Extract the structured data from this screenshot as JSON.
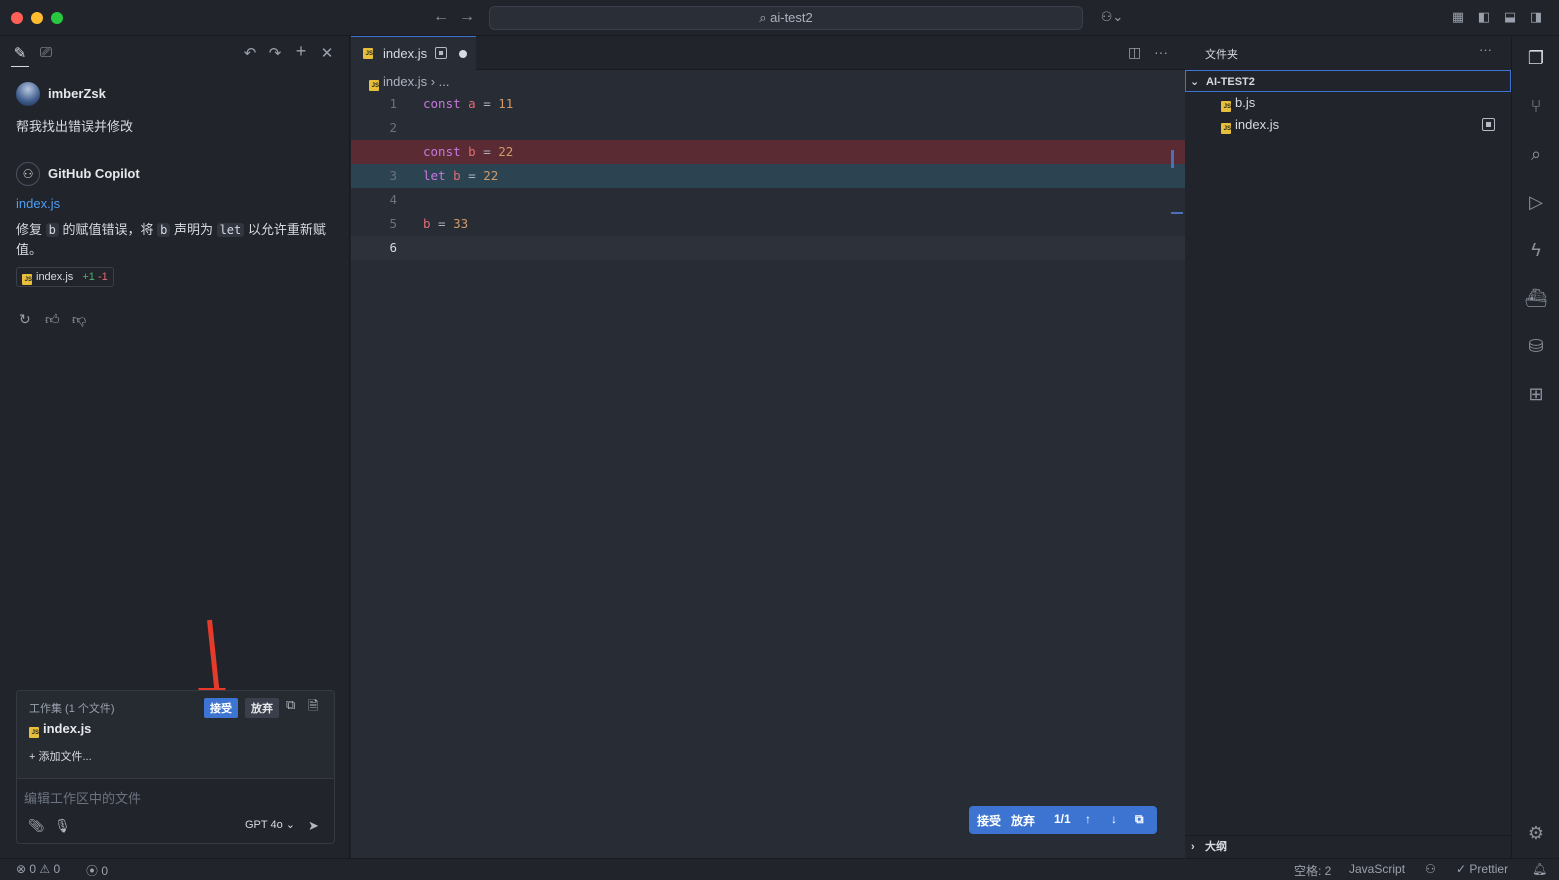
{
  "window": {
    "search_text": "⌕ ai-test2"
  },
  "chat": {
    "user": {
      "name": "imberZsk",
      "message": "帮我找出错误并修改"
    },
    "assistant": {
      "name": "GitHub Copilot",
      "file_link": "index.js",
      "explain_1": "修复 ",
      "explain_code_1": "b",
      "explain_2": " 的赋值错误，将 ",
      "explain_code_2": "b",
      "explain_3": " 声明为 ",
      "explain_code_3": "let",
      "explain_4": " 以允许重新赋值。",
      "chip_file": "index.js",
      "chip_add": "+1",
      "chip_del": "-1"
    },
    "working_set": {
      "title": "工作集 (1 个文件)",
      "accept": "接受",
      "discard": "放弃",
      "file": "index.js",
      "add_files": "+ 添加文件...",
      "input_placeholder": "编辑工作区中的文件",
      "model": "GPT 4o ⌄"
    }
  },
  "editor": {
    "tab_label": "index.js",
    "breadcrumb": "index.js  ›  ...",
    "lines": [
      {
        "n": "1",
        "kw": "const",
        "var": "a",
        "op": " = ",
        "num": "11"
      },
      {
        "n": "2"
      },
      {
        "n": "",
        "kw": "const",
        "var": "b",
        "op": " = ",
        "num": "22"
      },
      {
        "n": "3",
        "kw": "let",
        "var": "b",
        "op": " = ",
        "num": "22"
      },
      {
        "n": "4"
      },
      {
        "n": "5",
        "kw": "",
        "var": "b",
        "op": " = ",
        "num": "33"
      },
      {
        "n": "6"
      }
    ],
    "diff_bar": {
      "accept": "接受",
      "discard": "放弃",
      "count": "1/1"
    }
  },
  "explorer": {
    "title": "文件夹",
    "root": "AI-TEST2",
    "files": [
      "b.js",
      "index.js"
    ],
    "outline": "大纲"
  },
  "status": {
    "errors": "0",
    "warnings": "0",
    "ports": "0",
    "spaces": "空格: 2",
    "language": "JavaScript",
    "prettier": "✓ Prettier"
  }
}
